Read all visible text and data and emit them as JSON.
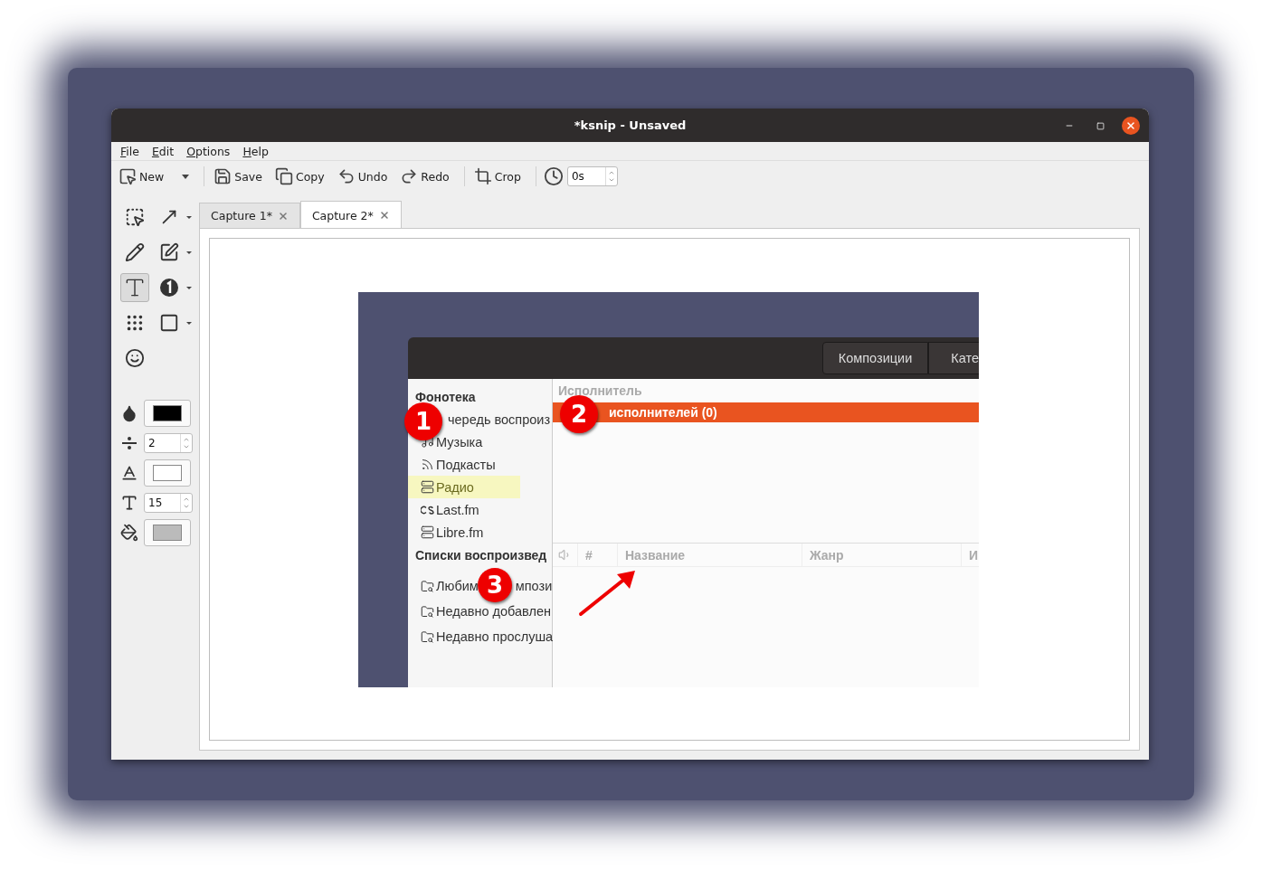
{
  "window": {
    "title": "*ksnip - Unsaved"
  },
  "menu": [
    "File",
    "Edit",
    "Options",
    "Help"
  ],
  "toolbar": [
    {
      "kind": "new",
      "label": "New"
    },
    {
      "kind": "save",
      "label": "Save"
    },
    {
      "kind": "copy",
      "label": "Copy"
    },
    {
      "kind": "undo",
      "label": "Undo"
    },
    {
      "kind": "redo",
      "label": "Redo"
    },
    {
      "kind": "crop",
      "label": "Crop"
    },
    {
      "kind": "delay",
      "value": "0s"
    }
  ],
  "tools": [
    {
      "kind": "select",
      "selected": false,
      "menu": false
    },
    {
      "kind": "arrow",
      "selected": false,
      "menu": true
    },
    {
      "kind": "pen",
      "selected": false,
      "menu": false
    },
    {
      "kind": "marker",
      "selected": false,
      "menu": true
    },
    {
      "kind": "text",
      "selected": true,
      "menu": false
    },
    {
      "kind": "number",
      "selected": false,
      "menu": true
    },
    {
      "kind": "blur",
      "selected": false,
      "menu": false
    },
    {
      "kind": "rect",
      "selected": false,
      "menu": true
    },
    {
      "kind": "sticker",
      "selected": false,
      "menu": false
    }
  ],
  "settings": [
    {
      "kind": "color",
      "color": "#000000"
    },
    {
      "kind": "width",
      "value": "2"
    },
    {
      "kind": "textcolor",
      "color": "#ffffff"
    },
    {
      "kind": "fontsize",
      "value": "15"
    },
    {
      "kind": "fill",
      "color": "#bbbbbb"
    }
  ],
  "tabs": [
    {
      "label": "Capture 1*",
      "selected": false
    },
    {
      "label": "Capture 2*",
      "selected": true
    }
  ],
  "capture": {
    "header_buttons": [
      "Композиции",
      "Кате"
    ],
    "sidebar": [
      {
        "heading": "Фонотека",
        "items": [
          {
            "kind": "queue",
            "label": "чередь воспроиз",
            "selected": false
          },
          {
            "kind": "music",
            "label": "Музыка",
            "selected": false
          },
          {
            "kind": "podcasts",
            "label": "Подкасты",
            "selected": false
          },
          {
            "kind": "radio",
            "label": "Радио",
            "selected": true
          },
          {
            "kind": "lastfm",
            "label": "Last.fm",
            "selected": false
          },
          {
            "kind": "librefm",
            "label": "Libre.fm",
            "selected": false
          }
        ]
      },
      {
        "heading": "Списки воспроизвед",
        "items": [
          {
            "kind": "playlist",
            "label": "Любим",
            "tail": "мпози",
            "selected": false
          },
          {
            "kind": "playlist",
            "label": "Недавно добавлен",
            "selected": false
          },
          {
            "kind": "playlist",
            "label": "Недавно прослуша",
            "selected": false
          }
        ]
      }
    ],
    "artists_column": "Исполнитель",
    "artist_rows": [
      {
        "label": "исполнителей (0)",
        "selected": true
      }
    ],
    "track_columns": [
      "#",
      "Название",
      "Жанр",
      "И"
    ],
    "markers": [
      "1",
      "2",
      "3"
    ]
  }
}
